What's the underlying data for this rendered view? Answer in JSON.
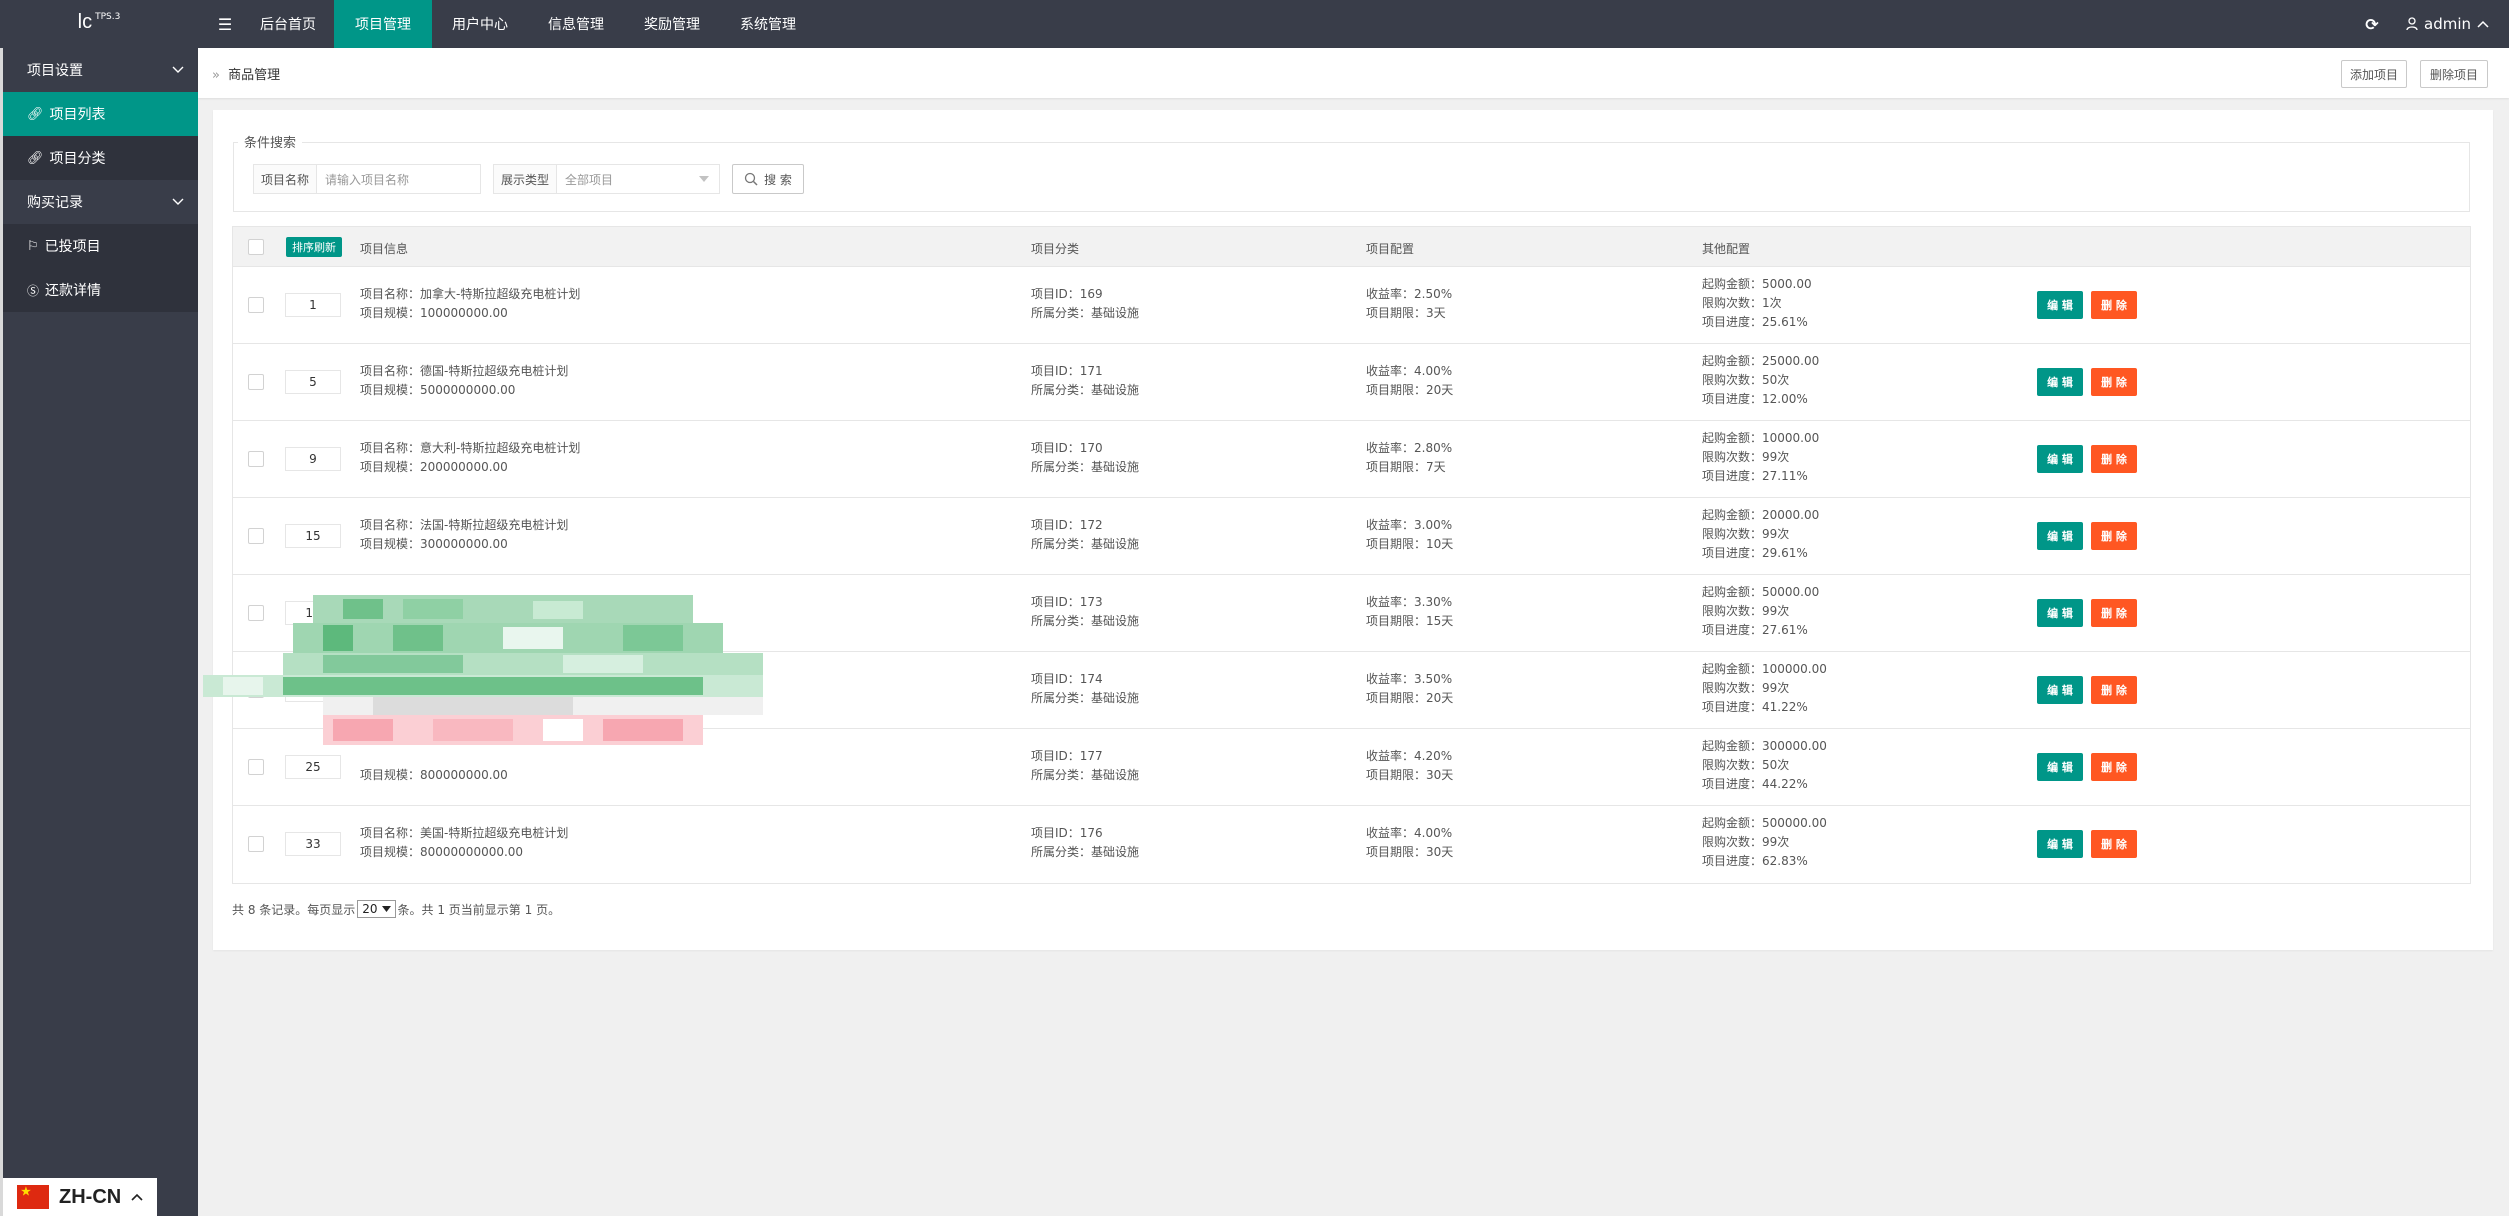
{
  "logo": {
    "name": "lc",
    "version": "TPS.3"
  },
  "nav": {
    "toggle_icon": "menu-icon",
    "items": [
      {
        "label": "后台首页",
        "active": false
      },
      {
        "label": "项目管理",
        "active": true
      },
      {
        "label": "用户中心",
        "active": false
      },
      {
        "label": "信息管理",
        "active": false
      },
      {
        "label": "奖励管理",
        "active": false
      },
      {
        "label": "系统管理",
        "active": false
      }
    ],
    "user": "admin"
  },
  "sidebar": {
    "groups": [
      {
        "label": "项目设置",
        "items": [
          {
            "label": "项目列表",
            "icon": "link-icon",
            "active": true
          },
          {
            "label": "项目分类",
            "icon": "link-icon",
            "active": false
          }
        ]
      },
      {
        "label": "购买记录",
        "items": [
          {
            "label": "已投项目",
            "icon": "flag-icon",
            "active": false
          },
          {
            "label": "还款详情",
            "icon": "dollar-icon",
            "active": false
          }
        ]
      }
    ]
  },
  "language": {
    "code": "ZH-CN"
  },
  "breadcrumb": {
    "separator": "»",
    "current": "商品管理"
  },
  "toolbar": {
    "add_label": "添加项目",
    "delete_label": "删除项目"
  },
  "search": {
    "legend": "条件搜索",
    "name_label": "项目名称",
    "name_placeholder": "请输入项目名称",
    "type_label": "展示类型",
    "type_value": "全部项目",
    "button_label": "搜 索"
  },
  "table": {
    "sort_button": "排序刷新",
    "headers": [
      "项目信息",
      "项目分类",
      "项目配置",
      "其他配置"
    ],
    "edit_label": "编 辑",
    "delete_label": "删 除",
    "rows": [
      {
        "sort": "1",
        "name": "项目名称：加拿大-特斯拉超级充电桩计划",
        "scale": "项目规模：100000000.00",
        "id": "项目ID：169",
        "category": "所属分类：基础设施",
        "rate": "收益率：2.50%",
        "term": "项目期限：3天",
        "min_amount": "起购金额：5000.00",
        "limit": "限购次数：1次",
        "progress": "项目进度：25.61%"
      },
      {
        "sort": "5",
        "name": "项目名称：德国-特斯拉超级充电桩计划",
        "scale": "项目规模：5000000000.00",
        "id": "项目ID：171",
        "category": "所属分类：基础设施",
        "rate": "收益率：4.00%",
        "term": "项目期限：20天",
        "min_amount": "起购金额：25000.00",
        "limit": "限购次数：50次",
        "progress": "项目进度：12.00%"
      },
      {
        "sort": "9",
        "name": "项目名称：意大利-特斯拉超级充电桩计划",
        "scale": "项目规模：200000000.00",
        "id": "项目ID：170",
        "category": "所属分类：基础设施",
        "rate": "收益率：2.80%",
        "term": "项目期限：7天",
        "min_amount": "起购金额：10000.00",
        "limit": "限购次数：99次",
        "progress": "项目进度：27.11%"
      },
      {
        "sort": "15",
        "name": "项目名称：法国-特斯拉超级充电桩计划",
        "scale": "项目规模：300000000.00",
        "id": "项目ID：172",
        "category": "所属分类：基础设施",
        "rate": "收益率：3.00%",
        "term": "项目期限：10天",
        "min_amount": "起购金额：20000.00",
        "limit": "限购次数：99次",
        "progress": "项目进度：29.61%"
      },
      {
        "sort": "19",
        "name": "",
        "scale": "",
        "id": "项目ID：173",
        "category": "所属分类：基础设施",
        "rate": "收益率：3.30%",
        "term": "项目期限：15天",
        "min_amount": "起购金额：50000.00",
        "limit": "限购次数：99次",
        "progress": "项目进度：27.61%"
      },
      {
        "sort": "",
        "name": "",
        "scale": "",
        "id": "项目ID：174",
        "category": "所属分类：基础设施",
        "rate": "收益率：3.50%",
        "term": "项目期限：20天",
        "min_amount": "起购金额：100000.00",
        "limit": "限购次数：99次",
        "progress": "项目进度：41.22%"
      },
      {
        "sort": "25",
        "name": "",
        "scale": "项目规模：800000000.00",
        "id": "项目ID：177",
        "category": "所属分类：基础设施",
        "rate": "收益率：4.20%",
        "term": "项目期限：30天",
        "min_amount": "起购金额：300000.00",
        "limit": "限购次数：50次",
        "progress": "项目进度：44.22%"
      },
      {
        "sort": "33",
        "name": "项目名称：美国-特斯拉超级充电桩计划",
        "scale": "项目规模：80000000000.00",
        "id": "项目ID：176",
        "category": "所属分类：基础设施",
        "rate": "收益率：4.00%",
        "term": "项目期限：30天",
        "min_amount": "起购金额：500000.00",
        "limit": "限购次数：99次",
        "progress": "项目进度：62.83%"
      }
    ]
  },
  "pager": {
    "prefix": "共 8 条记录。每页显示",
    "page_size": "20",
    "suffix": "条。共 1 页当前显示第 1 页。"
  }
}
